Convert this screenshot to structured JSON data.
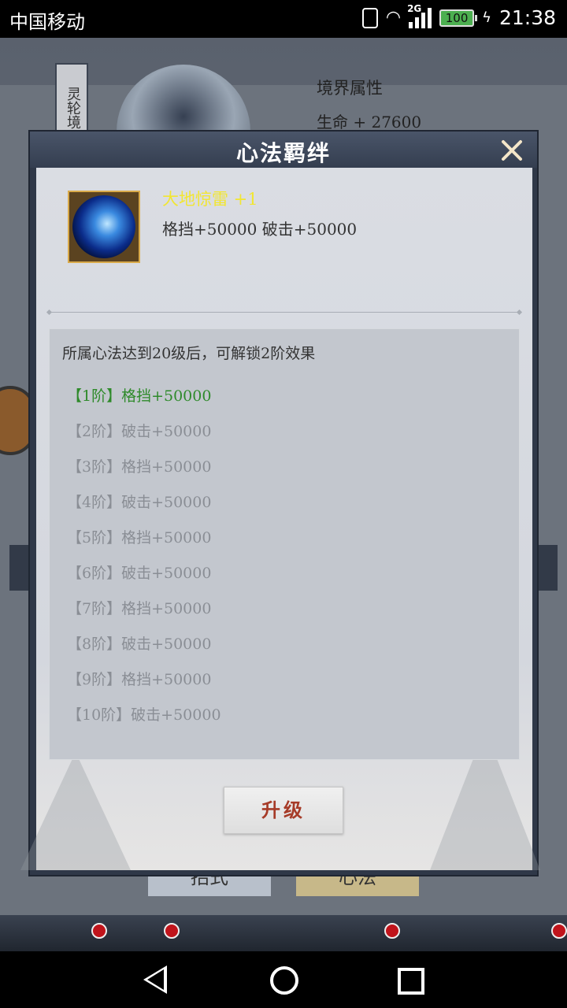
{
  "status_bar": {
    "carrier": "中国移动",
    "network": "2G",
    "battery": "100",
    "time": "21:38"
  },
  "background": {
    "tab_label": "灵轮境",
    "realm_title": "境界属性",
    "life_stat": "生命 + 27600",
    "bottom_tabs": [
      "招式",
      "心法"
    ]
  },
  "modal": {
    "title": "心法羁绊",
    "skill": {
      "name": "大地惊雷 +1",
      "stats": "格挡+50000 破击+50000"
    },
    "unlock_hint": "所属心法达到20级后，可解锁2阶效果",
    "tiers": [
      {
        "label": "【1阶】格挡+50000",
        "active": true
      },
      {
        "label": "【2阶】破击+50000",
        "active": false
      },
      {
        "label": "【3阶】格挡+50000",
        "active": false
      },
      {
        "label": "【4阶】破击+50000",
        "active": false
      },
      {
        "label": "【5阶】格挡+50000",
        "active": false
      },
      {
        "label": "【6阶】破击+50000",
        "active": false
      },
      {
        "label": "【7阶】格挡+50000",
        "active": false
      },
      {
        "label": "【8阶】破击+50000",
        "active": false
      },
      {
        "label": "【9阶】格挡+50000",
        "active": false
      },
      {
        "label": "【10阶】破击+50000",
        "active": false
      }
    ],
    "upgrade_label": "升级"
  },
  "colors": {
    "active_tier": "#2e8a2a",
    "inactive_tier": "#8a8e95",
    "skill_name": "#f2e632",
    "upgrade_text": "#a63b28"
  }
}
